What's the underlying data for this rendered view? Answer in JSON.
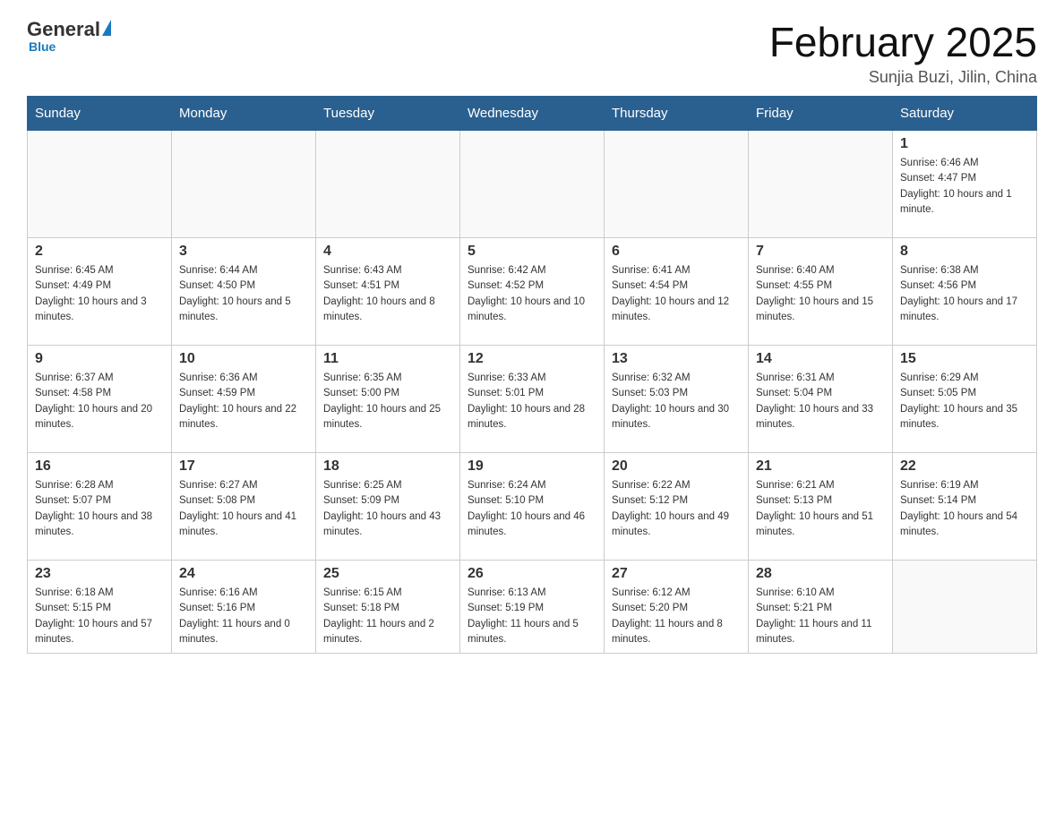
{
  "logo": {
    "general": "General",
    "blue": "Blue",
    "underline": "Blue"
  },
  "title": "February 2025",
  "location": "Sunjia Buzi, Jilin, China",
  "days_of_week": [
    "Sunday",
    "Monday",
    "Tuesday",
    "Wednesday",
    "Thursday",
    "Friday",
    "Saturday"
  ],
  "weeks": [
    [
      {
        "day": "",
        "info": ""
      },
      {
        "day": "",
        "info": ""
      },
      {
        "day": "",
        "info": ""
      },
      {
        "day": "",
        "info": ""
      },
      {
        "day": "",
        "info": ""
      },
      {
        "day": "",
        "info": ""
      },
      {
        "day": "1",
        "info": "Sunrise: 6:46 AM\nSunset: 4:47 PM\nDaylight: 10 hours and 1 minute."
      }
    ],
    [
      {
        "day": "2",
        "info": "Sunrise: 6:45 AM\nSunset: 4:49 PM\nDaylight: 10 hours and 3 minutes."
      },
      {
        "day": "3",
        "info": "Sunrise: 6:44 AM\nSunset: 4:50 PM\nDaylight: 10 hours and 5 minutes."
      },
      {
        "day": "4",
        "info": "Sunrise: 6:43 AM\nSunset: 4:51 PM\nDaylight: 10 hours and 8 minutes."
      },
      {
        "day": "5",
        "info": "Sunrise: 6:42 AM\nSunset: 4:52 PM\nDaylight: 10 hours and 10 minutes."
      },
      {
        "day": "6",
        "info": "Sunrise: 6:41 AM\nSunset: 4:54 PM\nDaylight: 10 hours and 12 minutes."
      },
      {
        "day": "7",
        "info": "Sunrise: 6:40 AM\nSunset: 4:55 PM\nDaylight: 10 hours and 15 minutes."
      },
      {
        "day": "8",
        "info": "Sunrise: 6:38 AM\nSunset: 4:56 PM\nDaylight: 10 hours and 17 minutes."
      }
    ],
    [
      {
        "day": "9",
        "info": "Sunrise: 6:37 AM\nSunset: 4:58 PM\nDaylight: 10 hours and 20 minutes."
      },
      {
        "day": "10",
        "info": "Sunrise: 6:36 AM\nSunset: 4:59 PM\nDaylight: 10 hours and 22 minutes."
      },
      {
        "day": "11",
        "info": "Sunrise: 6:35 AM\nSunset: 5:00 PM\nDaylight: 10 hours and 25 minutes."
      },
      {
        "day": "12",
        "info": "Sunrise: 6:33 AM\nSunset: 5:01 PM\nDaylight: 10 hours and 28 minutes."
      },
      {
        "day": "13",
        "info": "Sunrise: 6:32 AM\nSunset: 5:03 PM\nDaylight: 10 hours and 30 minutes."
      },
      {
        "day": "14",
        "info": "Sunrise: 6:31 AM\nSunset: 5:04 PM\nDaylight: 10 hours and 33 minutes."
      },
      {
        "day": "15",
        "info": "Sunrise: 6:29 AM\nSunset: 5:05 PM\nDaylight: 10 hours and 35 minutes."
      }
    ],
    [
      {
        "day": "16",
        "info": "Sunrise: 6:28 AM\nSunset: 5:07 PM\nDaylight: 10 hours and 38 minutes."
      },
      {
        "day": "17",
        "info": "Sunrise: 6:27 AM\nSunset: 5:08 PM\nDaylight: 10 hours and 41 minutes."
      },
      {
        "day": "18",
        "info": "Sunrise: 6:25 AM\nSunset: 5:09 PM\nDaylight: 10 hours and 43 minutes."
      },
      {
        "day": "19",
        "info": "Sunrise: 6:24 AM\nSunset: 5:10 PM\nDaylight: 10 hours and 46 minutes."
      },
      {
        "day": "20",
        "info": "Sunrise: 6:22 AM\nSunset: 5:12 PM\nDaylight: 10 hours and 49 minutes."
      },
      {
        "day": "21",
        "info": "Sunrise: 6:21 AM\nSunset: 5:13 PM\nDaylight: 10 hours and 51 minutes."
      },
      {
        "day": "22",
        "info": "Sunrise: 6:19 AM\nSunset: 5:14 PM\nDaylight: 10 hours and 54 minutes."
      }
    ],
    [
      {
        "day": "23",
        "info": "Sunrise: 6:18 AM\nSunset: 5:15 PM\nDaylight: 10 hours and 57 minutes."
      },
      {
        "day": "24",
        "info": "Sunrise: 6:16 AM\nSunset: 5:16 PM\nDaylight: 11 hours and 0 minutes."
      },
      {
        "day": "25",
        "info": "Sunrise: 6:15 AM\nSunset: 5:18 PM\nDaylight: 11 hours and 2 minutes."
      },
      {
        "day": "26",
        "info": "Sunrise: 6:13 AM\nSunset: 5:19 PM\nDaylight: 11 hours and 5 minutes."
      },
      {
        "day": "27",
        "info": "Sunrise: 6:12 AM\nSunset: 5:20 PM\nDaylight: 11 hours and 8 minutes."
      },
      {
        "day": "28",
        "info": "Sunrise: 6:10 AM\nSunset: 5:21 PM\nDaylight: 11 hours and 11 minutes."
      },
      {
        "day": "",
        "info": ""
      }
    ]
  ]
}
